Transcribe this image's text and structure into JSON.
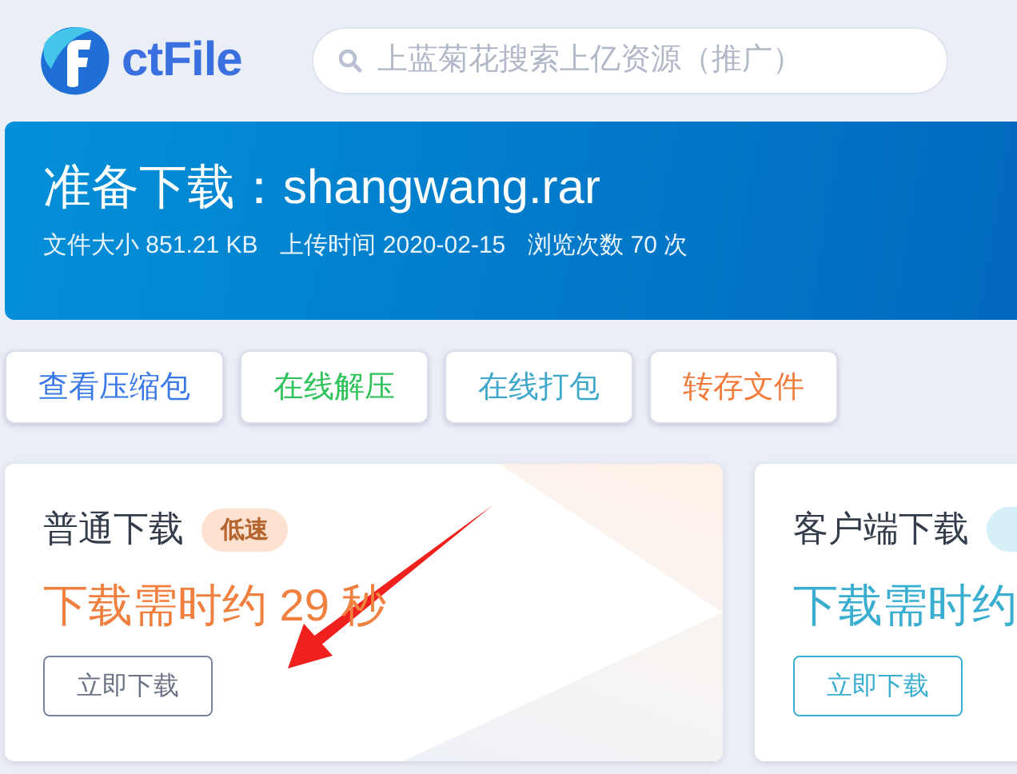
{
  "header": {
    "logo_text": "ctFile",
    "search": {
      "placeholder": "上蓝菊花搜索上亿资源（推广）"
    }
  },
  "banner": {
    "title": "准备下载：shangwang.rar",
    "meta": [
      {
        "label": "文件大小",
        "value": "851.21 KB"
      },
      {
        "label": "上传时间",
        "value": "2020-02-15"
      },
      {
        "label": "浏览次数",
        "value": "70 次"
      }
    ]
  },
  "actions": [
    {
      "label": "查看压缩包",
      "color": "#3b78e7"
    },
    {
      "label": "在线解压",
      "color": "#2fc25b"
    },
    {
      "label": "在线打包",
      "color": "#3fa7c9"
    },
    {
      "label": "转存文件",
      "color": "#f27b3c"
    }
  ],
  "cards": [
    {
      "kind": "normal",
      "title": "普通下载",
      "badge": "低速",
      "time": "下载需时约 29 秒",
      "button": "立即下载",
      "color": "#f08040"
    },
    {
      "kind": "client",
      "title": "客户端下载",
      "time": "下载需时约",
      "button": "立即下载",
      "color": "#3aaed0"
    }
  ]
}
